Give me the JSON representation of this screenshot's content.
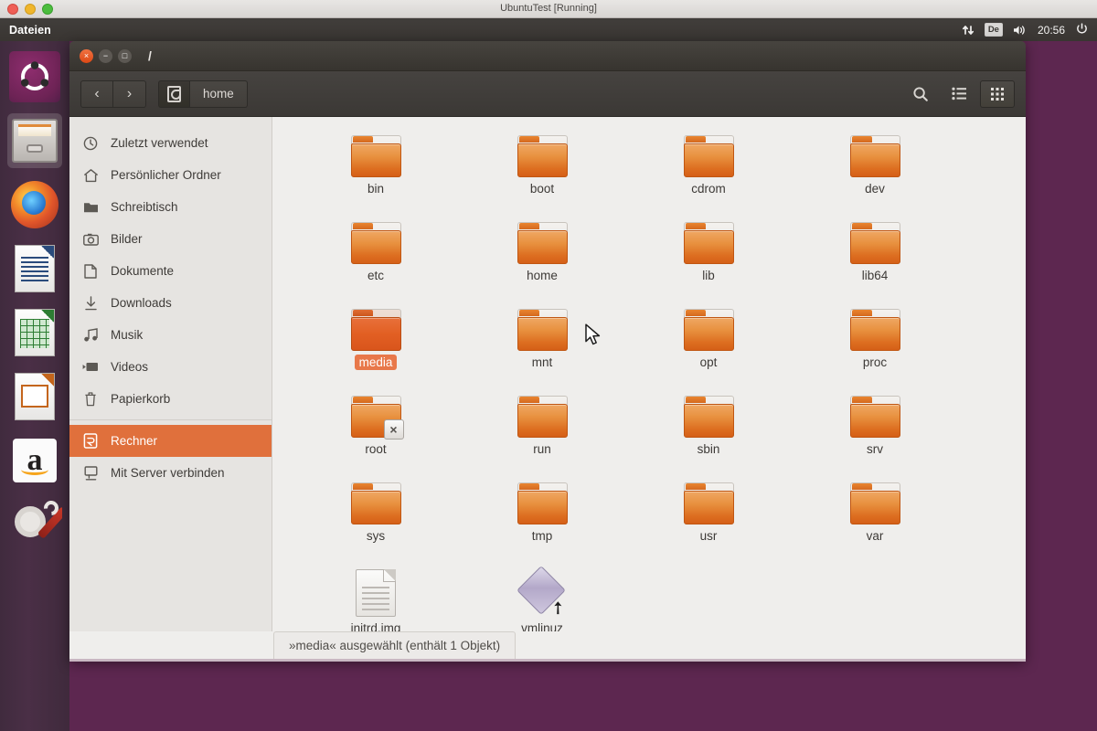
{
  "host": {
    "vm_title": "UbuntuTest [Running]",
    "traffic_lights": [
      "close-button",
      "minimize-button",
      "zoom-button"
    ]
  },
  "top_panel": {
    "app_name": "Dateien",
    "indicators": {
      "network_icon": "network-updown-icon",
      "keyboard_layout": "De",
      "volume_icon": "volume-icon",
      "clock": "20:56",
      "session_icon": "power-gear-icon"
    }
  },
  "launcher": {
    "items": [
      {
        "name": "dash-home",
        "icon": "ubuntu-logo-icon",
        "running": false
      },
      {
        "name": "files-nautilus",
        "icon": "file-cabinet-icon",
        "running": true
      },
      {
        "name": "firefox",
        "icon": "firefox-icon",
        "running": false
      },
      {
        "name": "libreoffice-writer",
        "icon": "writer-document-icon",
        "running": false
      },
      {
        "name": "libreoffice-calc",
        "icon": "calc-spreadsheet-icon",
        "running": false
      },
      {
        "name": "libreoffice-impress",
        "icon": "impress-slide-icon",
        "running": false
      },
      {
        "name": "amazon",
        "icon": "amazon-icon",
        "running": false
      },
      {
        "name": "system-settings",
        "icon": "gear-wrench-icon",
        "running": false
      }
    ]
  },
  "window": {
    "title": "/",
    "buttons": {
      "close": "×",
      "minimize": "−",
      "maximize": "□"
    },
    "toolbar": {
      "back_label": "‹",
      "forward_label": "›",
      "breadcrumbs": [
        {
          "label": "",
          "icon": "computer-icon"
        },
        {
          "label": "home",
          "icon": ""
        }
      ],
      "search_icon": "search-icon",
      "list_view_icon": "list-view-icon",
      "grid_view_icon": "grid-view-icon",
      "active_view": "grid-view-icon"
    }
  },
  "sidebar": {
    "items": [
      {
        "label": "Zuletzt verwendet",
        "icon": "clock-icon",
        "selected": false
      },
      {
        "label": "Persönlicher Ordner",
        "icon": "home-icon",
        "selected": false
      },
      {
        "label": "Schreibtisch",
        "icon": "folder-icon",
        "selected": false
      },
      {
        "label": "Bilder",
        "icon": "camera-icon",
        "selected": false
      },
      {
        "label": "Dokumente",
        "icon": "document-icon",
        "selected": false
      },
      {
        "label": "Downloads",
        "icon": "download-icon",
        "selected": false
      },
      {
        "label": "Musik",
        "icon": "music-note-icon",
        "selected": false
      },
      {
        "label": "Videos",
        "icon": "video-icon",
        "selected": false
      },
      {
        "label": "Papierkorb",
        "icon": "trash-icon",
        "selected": false
      },
      {
        "label": "Rechner",
        "icon": "computer-icon",
        "selected": true
      },
      {
        "label": "Mit Server verbinden",
        "icon": "server-icon",
        "selected": false
      }
    ]
  },
  "files": [
    {
      "label": "bin",
      "type": "folder",
      "selected": false,
      "badge": ""
    },
    {
      "label": "boot",
      "type": "folder",
      "selected": false,
      "badge": ""
    },
    {
      "label": "cdrom",
      "type": "folder",
      "selected": false,
      "badge": ""
    },
    {
      "label": "dev",
      "type": "folder",
      "selected": false,
      "badge": ""
    },
    {
      "label": "etc",
      "type": "folder",
      "selected": false,
      "badge": ""
    },
    {
      "label": "home",
      "type": "folder",
      "selected": false,
      "badge": ""
    },
    {
      "label": "lib",
      "type": "folder",
      "selected": false,
      "badge": ""
    },
    {
      "label": "lib64",
      "type": "folder",
      "selected": false,
      "badge": ""
    },
    {
      "label": "media",
      "type": "folder",
      "selected": true,
      "badge": ""
    },
    {
      "label": "mnt",
      "type": "folder",
      "selected": false,
      "badge": ""
    },
    {
      "label": "opt",
      "type": "folder",
      "selected": false,
      "badge": ""
    },
    {
      "label": "proc",
      "type": "folder",
      "selected": false,
      "badge": ""
    },
    {
      "label": "root",
      "type": "folder",
      "selected": false,
      "badge": "×"
    },
    {
      "label": "run",
      "type": "folder",
      "selected": false,
      "badge": ""
    },
    {
      "label": "sbin",
      "type": "folder",
      "selected": false,
      "badge": ""
    },
    {
      "label": "srv",
      "type": "folder",
      "selected": false,
      "badge": ""
    },
    {
      "label": "sys",
      "type": "folder",
      "selected": false,
      "badge": ""
    },
    {
      "label": "tmp",
      "type": "folder",
      "selected": false,
      "badge": ""
    },
    {
      "label": "usr",
      "type": "folder",
      "selected": false,
      "badge": ""
    },
    {
      "label": "var",
      "type": "folder",
      "selected": false,
      "badge": ""
    },
    {
      "label": "initrd.img",
      "type": "document",
      "selected": false,
      "badge": ""
    },
    {
      "label": "vmlinuz",
      "type": "symlink",
      "selected": false,
      "badge": ""
    }
  ],
  "statusbar": {
    "text": "»media« ausgewählt  (enthält 1 Objekt)"
  },
  "colors": {
    "desktop_background": "#5d2750",
    "accent_orange": "#e0703c",
    "panel_dark": "#3a3733",
    "folder_orange": "#dd6f21",
    "content_background": "#efeeec"
  }
}
